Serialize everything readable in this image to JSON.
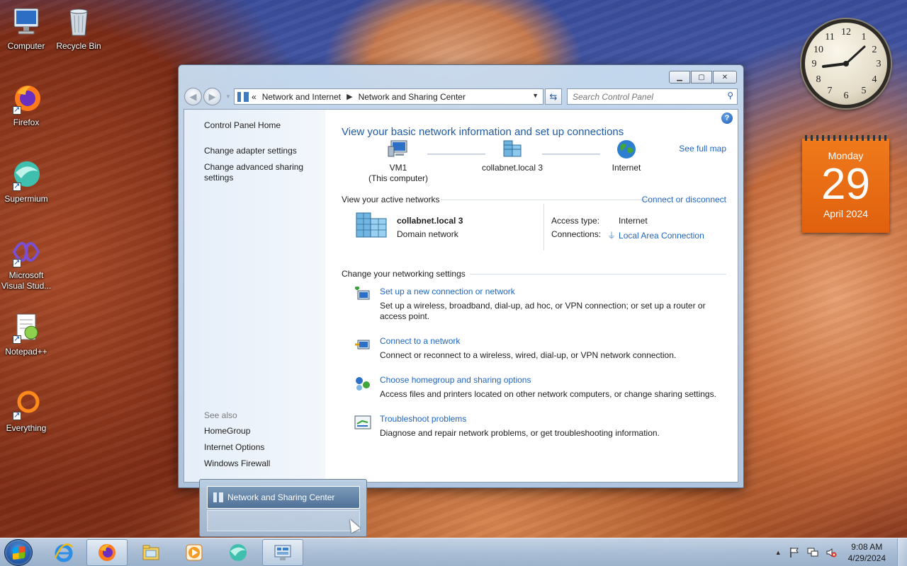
{
  "desktop": {
    "icons": [
      {
        "label": "Computer",
        "icon": "computer-icon"
      },
      {
        "label": "Recycle Bin",
        "icon": "recycle-bin-icon"
      },
      {
        "label": "Firefox",
        "icon": "firefox-icon"
      },
      {
        "label": "Supermium",
        "icon": "supermium-icon"
      },
      {
        "label": "Microsoft Visual Stud...",
        "icon": "visual-studio-icon"
      },
      {
        "label": "Notepad++",
        "icon": "notepad-plus-plus-icon"
      },
      {
        "label": "Everything",
        "icon": "everything-search-icon"
      }
    ]
  },
  "gadgets": {
    "clock": {
      "numbers": [
        "12",
        "1",
        "2",
        "3",
        "4",
        "5",
        "6",
        "7",
        "8",
        "9",
        "10",
        "11"
      ],
      "time": "9:08"
    },
    "calendar": {
      "day_name": "Monday",
      "day_number": "29",
      "month_year": "April 2024"
    }
  },
  "window": {
    "breadcrumb": {
      "prefix": "«",
      "items": [
        "Network and Internet",
        "Network and Sharing Center"
      ]
    },
    "search_placeholder": "Search Control Panel",
    "help_label": "?",
    "left_pane": {
      "links": [
        "Control Panel Home",
        "Change adapter settings",
        "Change advanced sharing settings"
      ],
      "see_also_label": "See also",
      "see_also": [
        "HomeGroup",
        "Internet Options",
        "Windows Firewall"
      ]
    },
    "main": {
      "title": "View your basic network information and set up connections",
      "see_full_map": "See full map",
      "map_nodes": [
        {
          "label": "VM1",
          "sublabel": "(This computer)",
          "icon": "computer-icon"
        },
        {
          "label": "collabnet.local  3",
          "sublabel": "",
          "icon": "domain-network-icon"
        },
        {
          "label": "Internet",
          "sublabel": "",
          "icon": "globe-icon"
        }
      ],
      "active_networks": {
        "heading": "View your active networks",
        "connect_link": "Connect or disconnect",
        "network_name": "collabnet.local  3",
        "network_type": "Domain network",
        "access_type_label": "Access type:",
        "access_type_value": "Internet",
        "connections_label": "Connections:",
        "connections_value": "Local Area Connection"
      },
      "settings_heading": "Change your networking settings",
      "tasks": [
        {
          "link": "Set up a new connection or network",
          "desc": "Set up a wireless, broadband, dial-up, ad hoc, or VPN connection; or set up a router or access point.",
          "icon": "new-connection-icon"
        },
        {
          "link": "Connect to a network",
          "desc": "Connect or reconnect to a wireless, wired, dial-up, or VPN network connection.",
          "icon": "connect-network-icon"
        },
        {
          "link": "Choose homegroup and sharing options",
          "desc": "Access files and printers located on other network computers, or change sharing settings.",
          "icon": "homegroup-icon"
        },
        {
          "link": "Troubleshoot problems",
          "desc": "Diagnose and repair network problems, or get troubleshooting information.",
          "icon": "troubleshoot-icon"
        }
      ]
    }
  },
  "thumbnail": {
    "title": "Network and Sharing Center"
  },
  "taskbar": {
    "apps": [
      "internet-explorer-icon",
      "firefox-icon",
      "file-explorer-icon",
      "media-player-icon",
      "supermium-icon",
      "control-panel-icon"
    ],
    "time": "9:08 AM",
    "date": "4/29/2024"
  },
  "colors": {
    "link": "#1f65c0",
    "title": "#1e5ba5",
    "calendar": "#e0600d"
  }
}
